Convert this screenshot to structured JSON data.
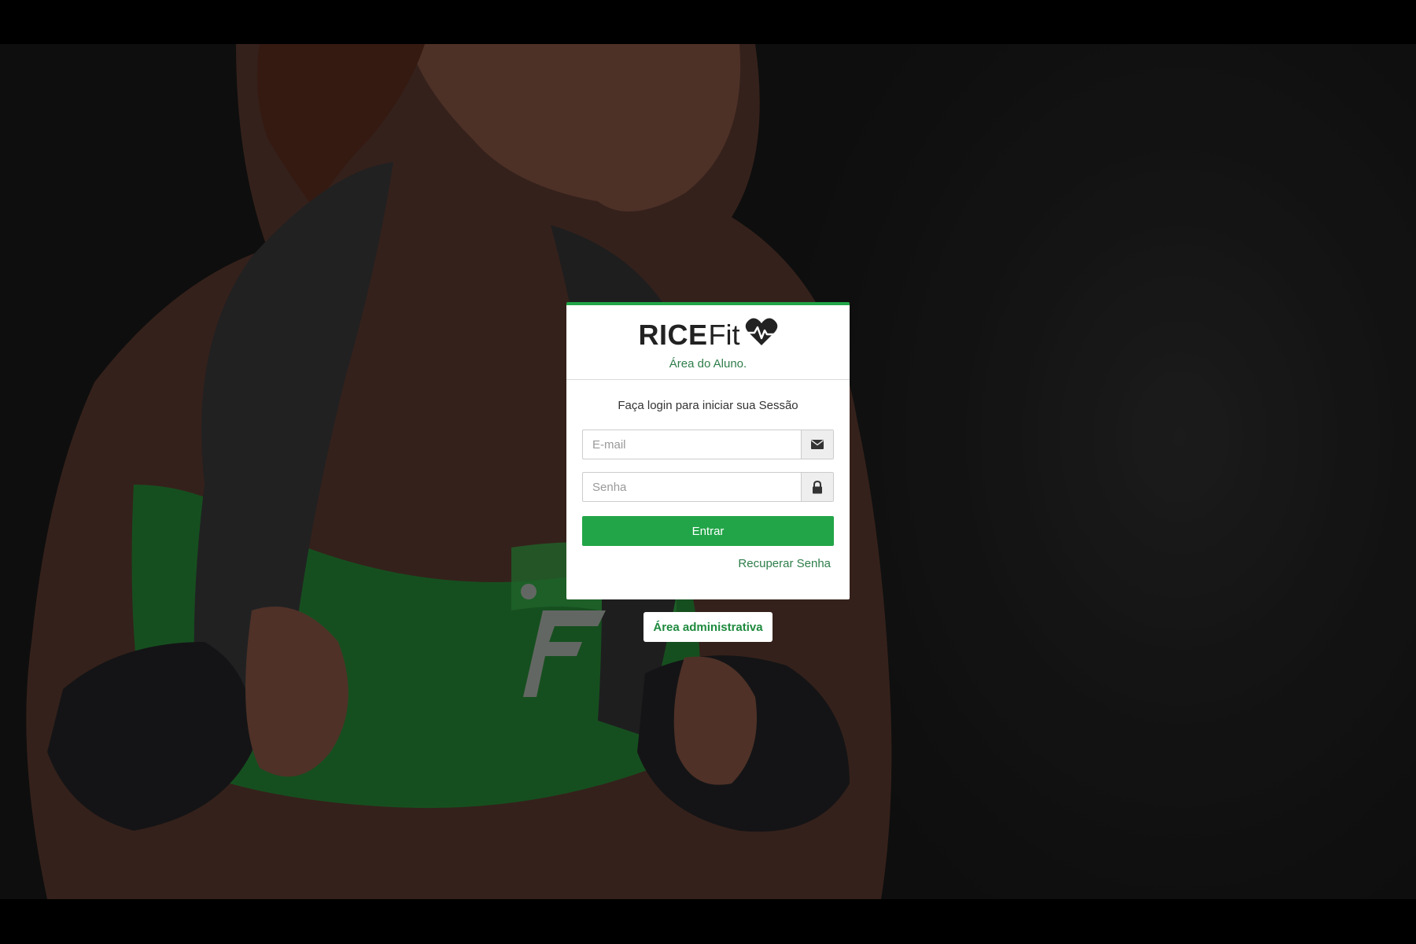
{
  "brand": {
    "name_bold": "RICE",
    "name_light": "Fit",
    "subtitle": "Área do Aluno."
  },
  "login": {
    "message": "Faça login para iniciar sua Sessão",
    "email_placeholder": "E-mail",
    "password_placeholder": "Senha",
    "submit_label": "Entrar",
    "recover_label": "Recuperar Senha"
  },
  "admin": {
    "label": "Área administrativa"
  },
  "icons": {
    "logo": "heartbeat-icon",
    "email": "envelope-icon",
    "password": "lock-icon"
  },
  "colors": {
    "accent": "#22a548",
    "link": "#2e7d4a",
    "background": "#171717"
  }
}
